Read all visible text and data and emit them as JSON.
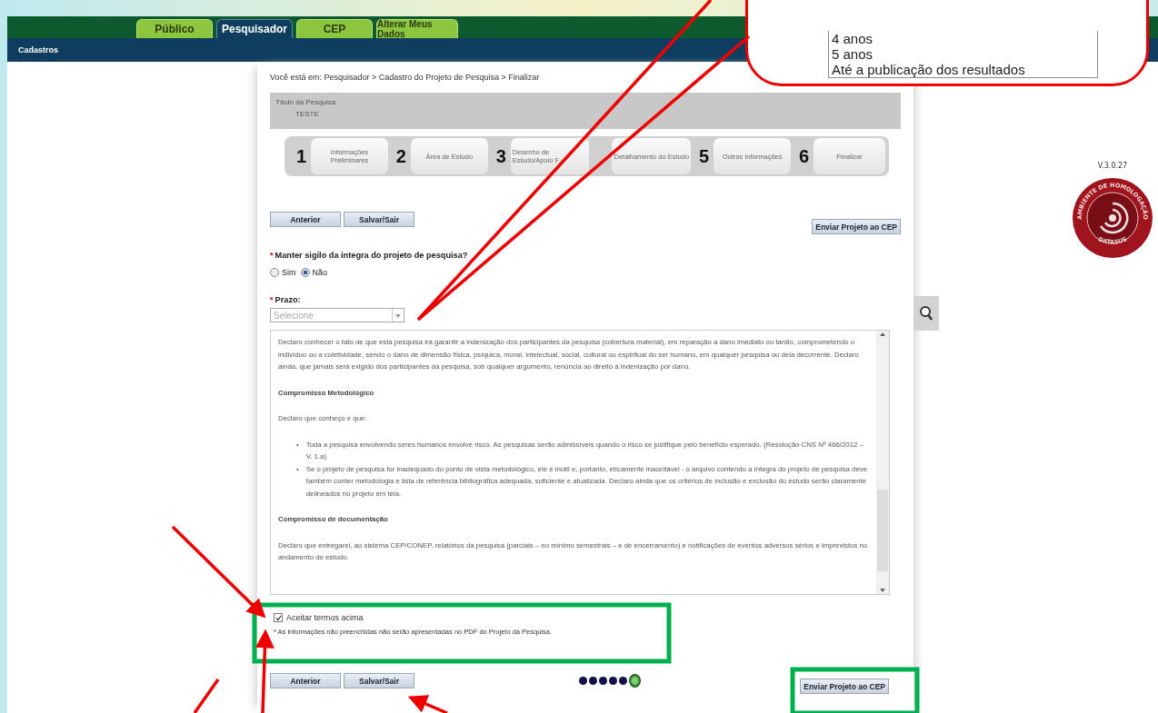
{
  "top_tabs": [
    {
      "label": "Público",
      "selected": false
    },
    {
      "label": "Pesquisador",
      "selected": true
    },
    {
      "label": "CEP",
      "selected": false
    },
    {
      "label": "Alterar Meus Dados",
      "selected": false
    }
  ],
  "subnav": {
    "items": [
      "Cadastros"
    ]
  },
  "breadcrumb": "Você está em: Pesquisador > Cadastro do Projeto de Pesquisa > Finalizar",
  "summary": {
    "label": "Título da Pesquisa",
    "value": "TESTE"
  },
  "wizard_steps": [
    {
      "number": "1",
      "label": "Informações Preliminares"
    },
    {
      "number": "2",
      "label": "Área de Estudo"
    },
    {
      "number": "3",
      "label": "Desenho de Estudo/Apoio F"
    },
    {
      "label": "Detalhamento do Estudo"
    },
    {
      "number": "5",
      "label": "Outras Informações"
    },
    {
      "number": "6",
      "label": "Finalizar"
    }
  ],
  "top_buttons": [
    "Anterior",
    "Salvar/Sair"
  ],
  "top_submit": "Enviar Projeto ao CEP",
  "secrecy": {
    "required_mark": "*",
    "label": "Manter sigilo da integra do projeto de pesquisa?",
    "options": [
      {
        "label": "Sim",
        "selected": false
      },
      {
        "label": "Não",
        "selected": true
      }
    ]
  },
  "deadline": {
    "required_mark": "*",
    "label": "Prazo:",
    "placeholder": "Selecione"
  },
  "terms": [
    {
      "kind": "paragraph",
      "text": "Declaro conhecer o fato de que esta pesquisa irá garantir a indenização dos participantes da pesquisa (cobertura material), em reparação a dano imediato ou tardio, comprometendo o indivíduo ou a coletividade, sendo o dano de dimensão física, psíquica, moral, intelectual, social, cultural ou espiritual do ser humano, em qualquer pesquisa ou dela decorrente. Declaro ainda, que jamais será exigido dos participantes da pesquisa, sob qualquer argumento, renúncia ao direito à indenização por dano."
    },
    {
      "kind": "heading",
      "text": "Compromisso Metodológico"
    },
    {
      "kind": "paragraph",
      "text": "Declaro que conheço e que:"
    },
    {
      "kind": "bullets",
      "marker": "•",
      "items": [
        "Toda a pesquisa envolvendo seres humanos envolve risco. As pesquisas serão admissíveis quando o risco se justifique pelo benefício esperado. (Resolução CNS Nº 466/2012 – V. 1.a)",
        "Se o projeto de pesquisa for inadequado do ponto de vista metodológico, ele é inútil e, portanto, eticamente inaceitável - o arquivo contendo a íntegra do projeto de pesquisa deve também conter metodologia e lista de referência bibliográfica adequada, suficiente e atualizada. Declaro ainda que os critérios de inclusão e exclusão do estudo serão claramente delineados no projeto em tela."
      ]
    },
    {
      "kind": "heading",
      "text": "Compromisso de documentação"
    },
    {
      "kind": "paragraph",
      "text": "Declaro que entregarei, ao sistema CEP/CONEP, relatórios da pesquisa (parciais – no mínimo semestrais – e de encerramento) e notificações de eventos adversos sérios e imprevistos no andamento do estudo."
    }
  ],
  "accept": {
    "label": "Aceitar termos acima",
    "checked": true
  },
  "note": "* As informações não preenchidas não serão apresentadas no PDF do Projeto da Pesquisa.",
  "bottom_buttons": [
    "Anterior",
    "Salvar/Sair"
  ],
  "progress_dots": [
    {
      "selected": false
    },
    {
      "selected": false
    },
    {
      "selected": false
    },
    {
      "selected": false
    },
    {
      "selected": false
    },
    {
      "selected": true
    }
  ],
  "bottom_submit": "Enviar Projeto ao CEP",
  "logo": {
    "version": "V.3.0.27",
    "ring_text": "AMBIENTE DE HOMOLOGAÇÃO",
    "bottom_text": "DATASUS"
  },
  "callout": {
    "options": [
      "4 anos",
      "5 anos",
      "Até a publicação dos resultados"
    ]
  }
}
